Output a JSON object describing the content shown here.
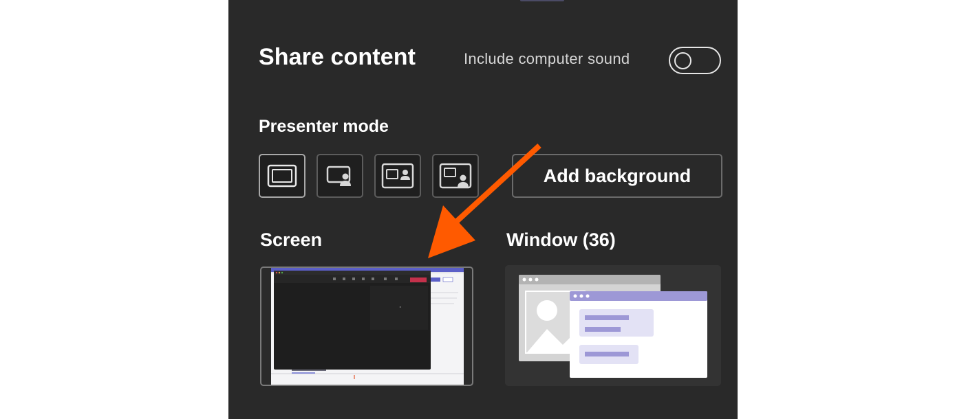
{
  "header": {
    "title": "Share content",
    "sound_label": "Include computer sound",
    "sound_enabled": false
  },
  "presenter": {
    "label": "Presenter mode",
    "modes": [
      {
        "icon": "content-only-icon",
        "selected": true
      },
      {
        "icon": "standout-icon",
        "selected": false
      },
      {
        "icon": "side-by-side-icon",
        "selected": false
      },
      {
        "icon": "reporter-icon",
        "selected": false
      }
    ],
    "add_background_label": "Add background"
  },
  "sources": {
    "screen_label": "Screen",
    "window_label": "Window (36)"
  },
  "colors": {
    "panel": "#292929",
    "accent_arrow": "#ff5a00",
    "illustration_purple": "#9d98d6",
    "illustration_light": "#e3e2f5"
  }
}
